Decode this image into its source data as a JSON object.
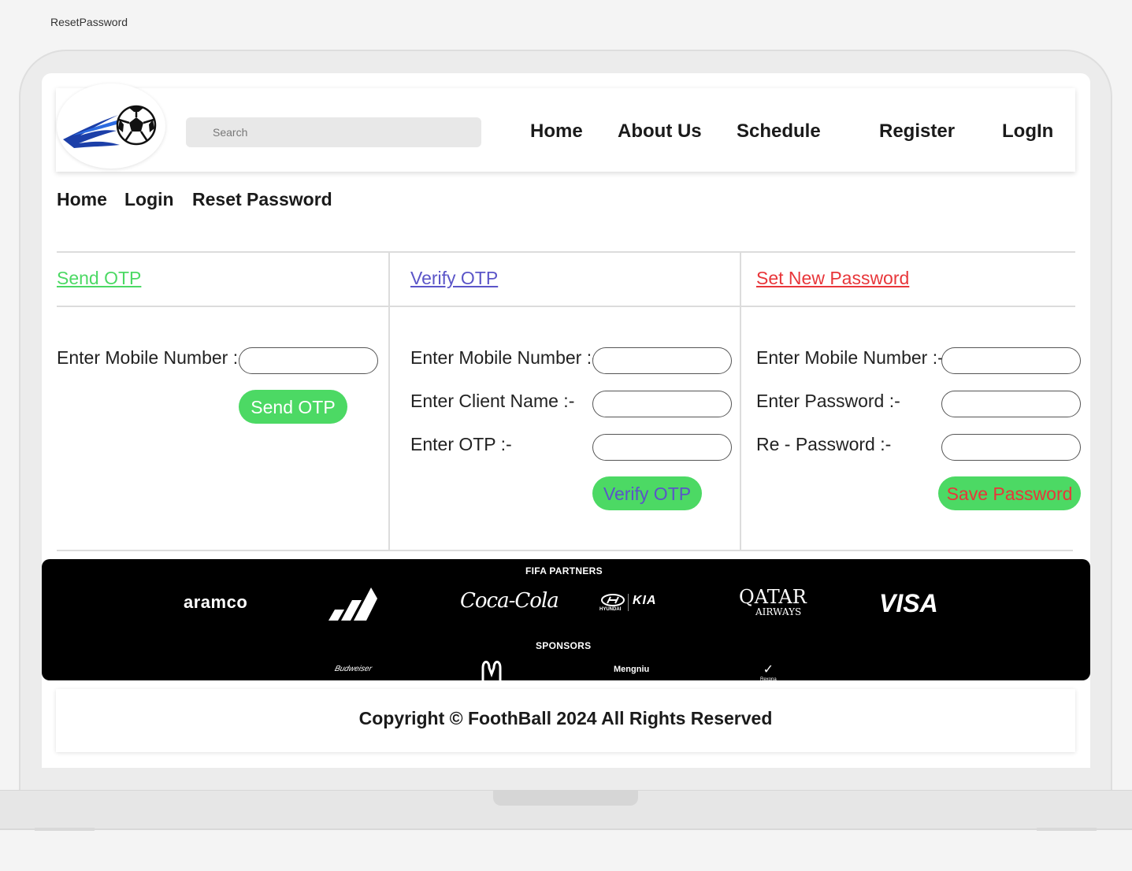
{
  "window_title": "ResetPassword",
  "search": {
    "placeholder": "Search"
  },
  "nav": [
    "Home",
    "About Us",
    "Schedule",
    "Register",
    "LogIn"
  ],
  "breadcrumb": [
    "Home",
    "Login",
    "Reset Password"
  ],
  "sections": {
    "send": {
      "title": "Send  OTP",
      "mobile_label": "Enter Mobile Number :-",
      "button": "Send OTP"
    },
    "verify": {
      "title": "Verify  OTP",
      "mobile_label": "Enter Mobile Number :-",
      "name_label": "Enter Client Name :-",
      "otp_label": "Enter OTP :-",
      "button": "Verify OTP"
    },
    "setpw": {
      "title": "Set New Password",
      "mobile_label": "Enter Mobile Number :-",
      "password_label": "Enter Password :-",
      "repassword_label": "Re - Password :-",
      "button": "Save  Password"
    }
  },
  "colors": {
    "send_title": "#4cd964",
    "verify_title": "#5b55c8",
    "setpw_title": "#e8363a",
    "button_bg": "#4cd964",
    "verify_button_text": "#5b55c8",
    "save_button_text": "#e8363a"
  },
  "sponsors": {
    "partners_caption": "FIFA PARTNERS",
    "partners": [
      "aramco",
      "adidas",
      "Coca-Cola",
      "HYUNDAI",
      "KIA",
      "QATAR",
      "AIRWAYS",
      "VISA"
    ],
    "sponsors_caption": "SPONSORS",
    "sponsors": [
      "Budweiser",
      "McDonald's",
      "Mengniu",
      "Rexona"
    ]
  },
  "footer": {
    "copyright": "Copyright © FoothBall 2024 All Rights Reserved"
  }
}
